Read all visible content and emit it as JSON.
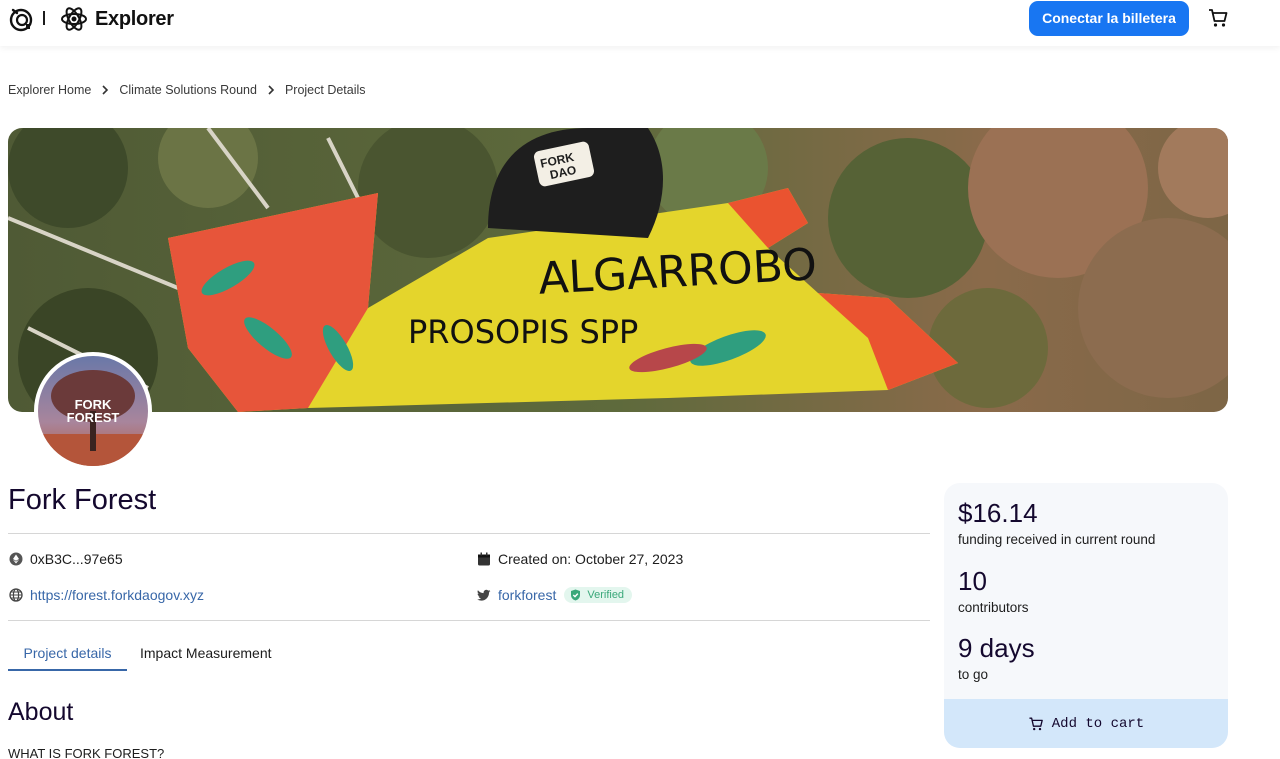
{
  "header": {
    "brand_text": "Explorer",
    "connect_wallet_label": "Conectar la billetera",
    "accent_color": "#1876f2"
  },
  "breadcrumb": [
    "Explorer Home",
    "Climate Solutions Round",
    "Project Details"
  ],
  "banner": {
    "sign_text_1": "ALGARROBO",
    "sign_text_2": "PROSOPIS SPP",
    "cap_text_1": "FORK",
    "cap_text_2": "DAO"
  },
  "avatar": {
    "logo_line_1": "FORK",
    "logo_line_2": "FOREST"
  },
  "project": {
    "title": "Fork Forest",
    "address": "0xB3C...97e65",
    "created_on": "Created on: October 27, 2023",
    "website": "https://forest.forkdaogov.xyz",
    "twitter": "forkforest",
    "verified_label": "Verified"
  },
  "tabs": [
    {
      "label": "Project details",
      "active": true
    },
    {
      "label": "Impact Measurement",
      "active": false
    }
  ],
  "about": {
    "heading": "About",
    "text": "WHAT IS FORK FOREST?"
  },
  "funding": {
    "amount": "$16.14",
    "amount_label": "funding received in current round",
    "contributors": "10",
    "contributors_label": "contributors",
    "days": "9 days",
    "days_label": "to go",
    "add_to_cart_label": "Add to cart"
  }
}
